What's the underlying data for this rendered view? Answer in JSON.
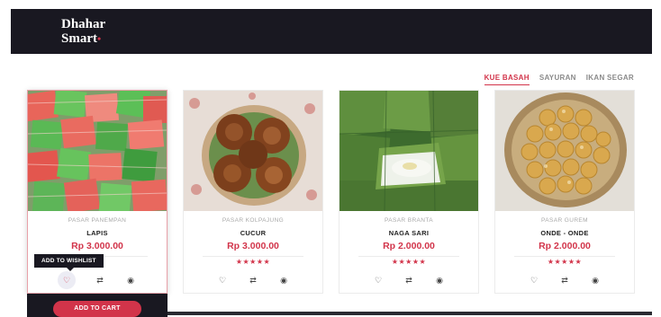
{
  "brand": {
    "line1": "Dhahar",
    "line2": "Smart"
  },
  "tabs": [
    {
      "label": "KUE BASAH",
      "active": true
    },
    {
      "label": "SAYURAN",
      "active": false
    },
    {
      "label": "IKAN SEGAR",
      "active": false
    }
  ],
  "products": [
    {
      "seller": "PASAR PANEMPAN",
      "name": "LAPIS",
      "price": "Rp 3.000.00",
      "rating": "★★★★★",
      "image": "lapis-cake-photo",
      "rating_value": 5
    },
    {
      "seller": "PASAR KOLPAJUNG",
      "name": "CUCUR",
      "price": "Rp 3.000.00",
      "rating": "★★★★★",
      "image": "cucur-cake-photo",
      "rating_value": 5
    },
    {
      "seller": "PASAR BRANTA",
      "name": "NAGA SARI",
      "price": "Rp 2.000.00",
      "rating": "★★★★★",
      "image": "naga-sari-photo",
      "rating_value": 5
    },
    {
      "seller": "PASAR GUREM",
      "name": "ONDE - ONDE",
      "price": "Rp 2.000.00",
      "rating": "★★★★★",
      "image": "onde-onde-photo",
      "rating_value": 5
    }
  ],
  "action_icons": {
    "wishlist": "♡",
    "compare": "⇄",
    "quick_view": "◉"
  },
  "tooltip": {
    "text": "ADD TO WISHLIST"
  },
  "cart": {
    "label": "ADD TO CART"
  },
  "colors": {
    "accent": "#d2344a",
    "dark": "#191821"
  }
}
